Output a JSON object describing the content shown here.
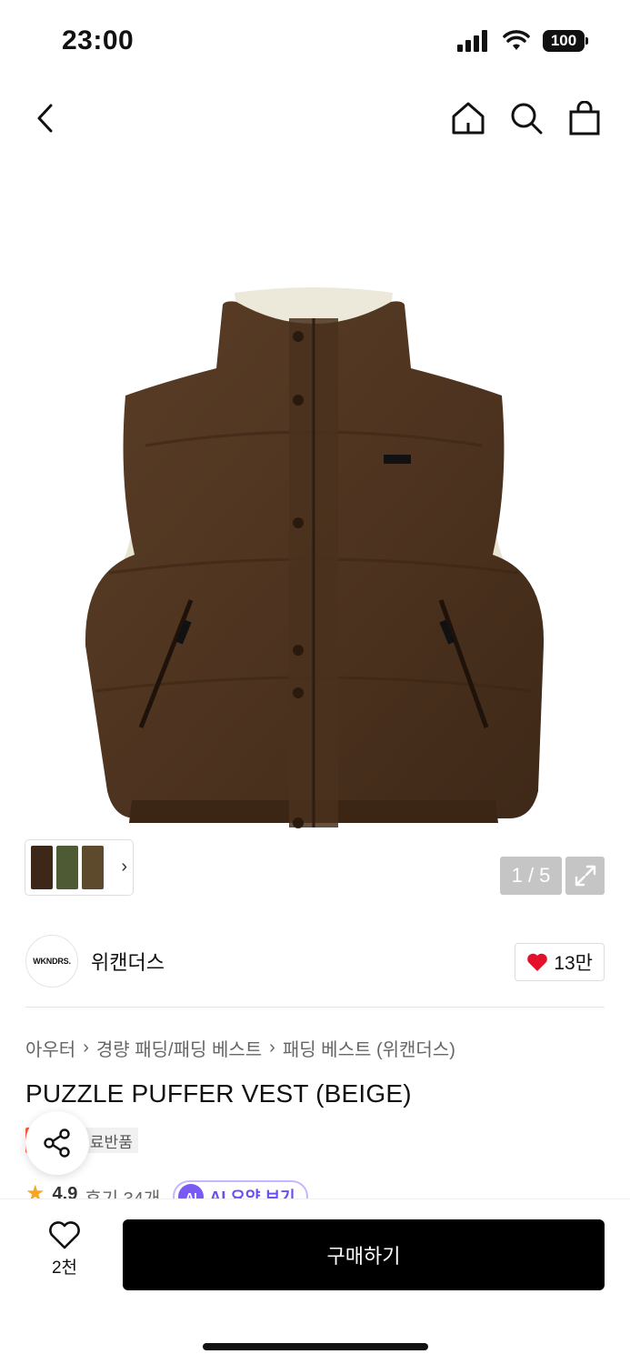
{
  "status_bar": {
    "time": "23:00",
    "battery": "100"
  },
  "brand": {
    "logo_text": "WKNDRS.",
    "name": "위캔더스",
    "likes": "13만"
  },
  "gallery": {
    "page_counter": "1 / 5"
  },
  "breadcrumb": [
    "아우터",
    "경량 패딩/패딩 베스트",
    "패딩 베스트 (위캔더스)"
  ],
  "product": {
    "title": "PUZZLE PUFFER VEST (BEIGE)",
    "badges": {
      "sale": "세일",
      "free_gift": "무료반품"
    },
    "rating": "4.9",
    "reviews": "후기 34개",
    "ai_badge": "AI",
    "ai_label": "AI 요약 보기"
  },
  "bottom_bar": {
    "wish_count": "2천",
    "buy_label": "구매하기"
  },
  "colors": {
    "accent_sale": "#ff5a36",
    "ai_purple": "#7a5af5",
    "heart_red": "#e4112c",
    "vest_brown": "#4e3420"
  },
  "icons": [
    "back-arrow-icon",
    "home-icon",
    "search-icon",
    "shopping-bag-icon",
    "expand-icon",
    "heart-icon",
    "share-icon",
    "star-icon"
  ]
}
